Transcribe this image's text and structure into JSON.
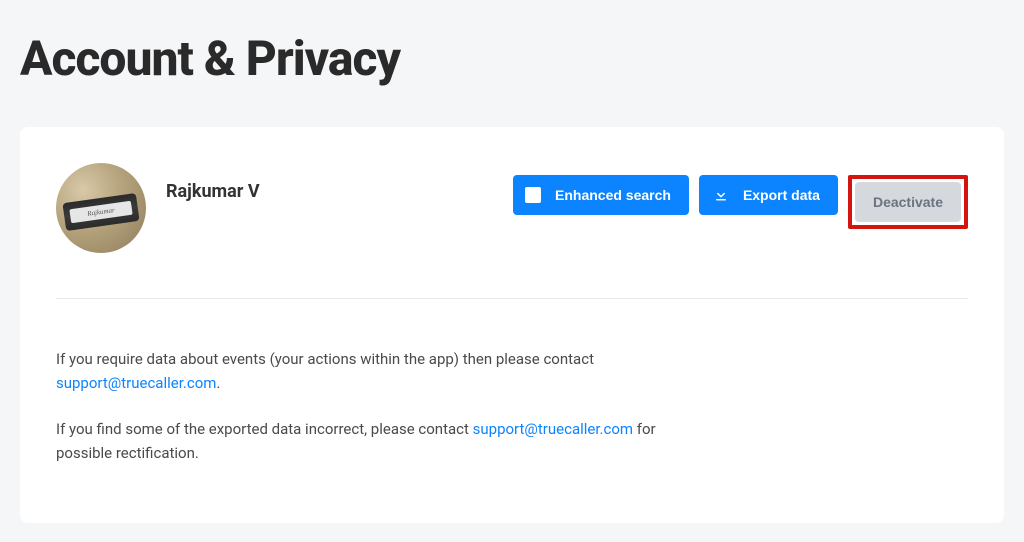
{
  "page": {
    "title": "Account & Privacy"
  },
  "profile": {
    "name": "Rajkumar V"
  },
  "buttons": {
    "enhanced_search": "Enhanced search",
    "export_data": "Export data",
    "deactivate": "Deactivate"
  },
  "info": {
    "p1_a": "If you require data about events (your actions within the app) then please contact ",
    "p1_link": "support@truecaller.com",
    "p1_b": ".",
    "p2_a": "If you find some of the exported data incorrect, please contact ",
    "p2_link": "support@truecaller.com",
    "p2_b": " for possible rectification."
  }
}
